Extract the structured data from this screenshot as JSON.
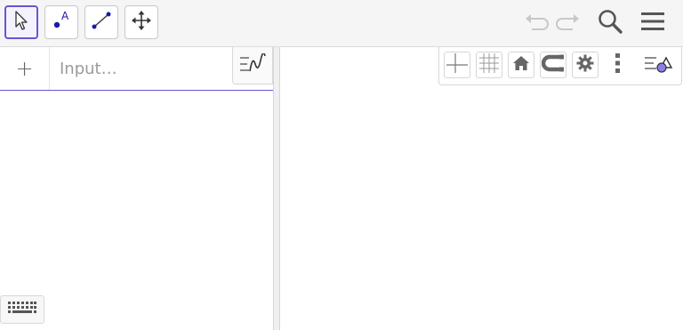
{
  "toolbar": {
    "tools": [
      {
        "name": "move-tool",
        "icon": "cursor-arrow-icon",
        "active": true
      },
      {
        "name": "point-tool",
        "icon": "point-icon",
        "point_label": "A"
      },
      {
        "name": "segment-tool",
        "icon": "segment-icon"
      },
      {
        "name": "move-graphics-view-tool",
        "icon": "move-arrows-icon"
      }
    ],
    "right_actions": [
      "undo-icon",
      "redo-icon",
      "search-icon",
      "menu-icon"
    ]
  },
  "algebra": {
    "add_icon": "+",
    "input_placeholder": "Input…",
    "input_value": ""
  },
  "graphics_style_bar": {
    "buttons": [
      "axes-icon",
      "grid-icon",
      "home-icon",
      "point-capturing-icon",
      "gear-icon",
      "more-vert-icon",
      "graphics-style-icon"
    ]
  },
  "colors": {
    "accent": "#6557d2",
    "point_blue": "#1a1aa6",
    "icon_gray": "#6e6e6e"
  }
}
